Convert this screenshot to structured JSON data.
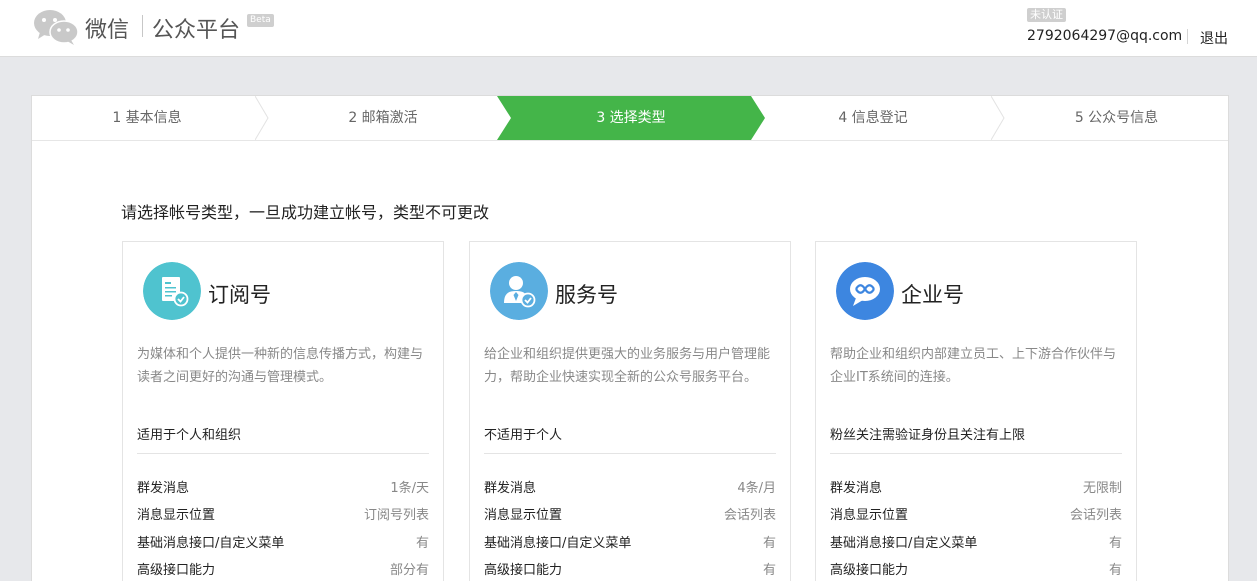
{
  "header": {
    "brand_wechat": "微信",
    "brand_mp": "公众平台",
    "beta": "Beta",
    "unverified": "未认证",
    "account": "2792064297@qq.com",
    "logout": "退出"
  },
  "steps": [
    {
      "label": "1 基本信息"
    },
    {
      "label": "2 邮箱激活"
    },
    {
      "label": "3 选择类型"
    },
    {
      "label": "4 信息登记"
    },
    {
      "label": "5 公众号信息"
    }
  ],
  "active_step_color": "#44b549",
  "prompt": "请选择帐号类型，一旦成功建立帐号，类型不可更改",
  "cards": [
    {
      "title": "订阅号",
      "icon": "subscription-doc-icon",
      "icon_color": "#4fc3cf",
      "desc": "为媒体和个人提供一种新的信息传播方式，构建与读者之间更好的沟通与管理模式。",
      "suit": "适用于个人和组织",
      "features": [
        {
          "name": "群发消息",
          "value": "1条/天"
        },
        {
          "name": "消息显示位置",
          "value": "订阅号列表"
        },
        {
          "name": "基础消息接口/自定义菜单",
          "value": "有"
        },
        {
          "name": "高级接口能力",
          "value": "部分有"
        }
      ]
    },
    {
      "title": "服务号",
      "icon": "service-person-icon",
      "icon_color": "#5aaee0",
      "desc": "给企业和组织提供更强大的业务服务与用户管理能力，帮助企业快速实现全新的公众号服务平台。",
      "suit": "不适用于个人",
      "features": [
        {
          "name": "群发消息",
          "value": "4条/月"
        },
        {
          "name": "消息显示位置",
          "value": "会话列表"
        },
        {
          "name": "基础消息接口/自定义菜单",
          "value": "有"
        },
        {
          "name": "高级接口能力",
          "value": "有"
        }
      ]
    },
    {
      "title": "企业号",
      "icon": "enterprise-chat-icon",
      "icon_color": "#3d86e0",
      "desc": "帮助企业和组织内部建立员工、上下游合作伙伴与企业IT系统间的连接。",
      "suit": "粉丝关注需验证身份且关注有上限",
      "features": [
        {
          "name": "群发消息",
          "value": "无限制"
        },
        {
          "name": "消息显示位置",
          "value": "会话列表"
        },
        {
          "name": "基础消息接口/自定义菜单",
          "value": "有"
        },
        {
          "name": "高级接口能力",
          "value": "有"
        }
      ]
    }
  ]
}
